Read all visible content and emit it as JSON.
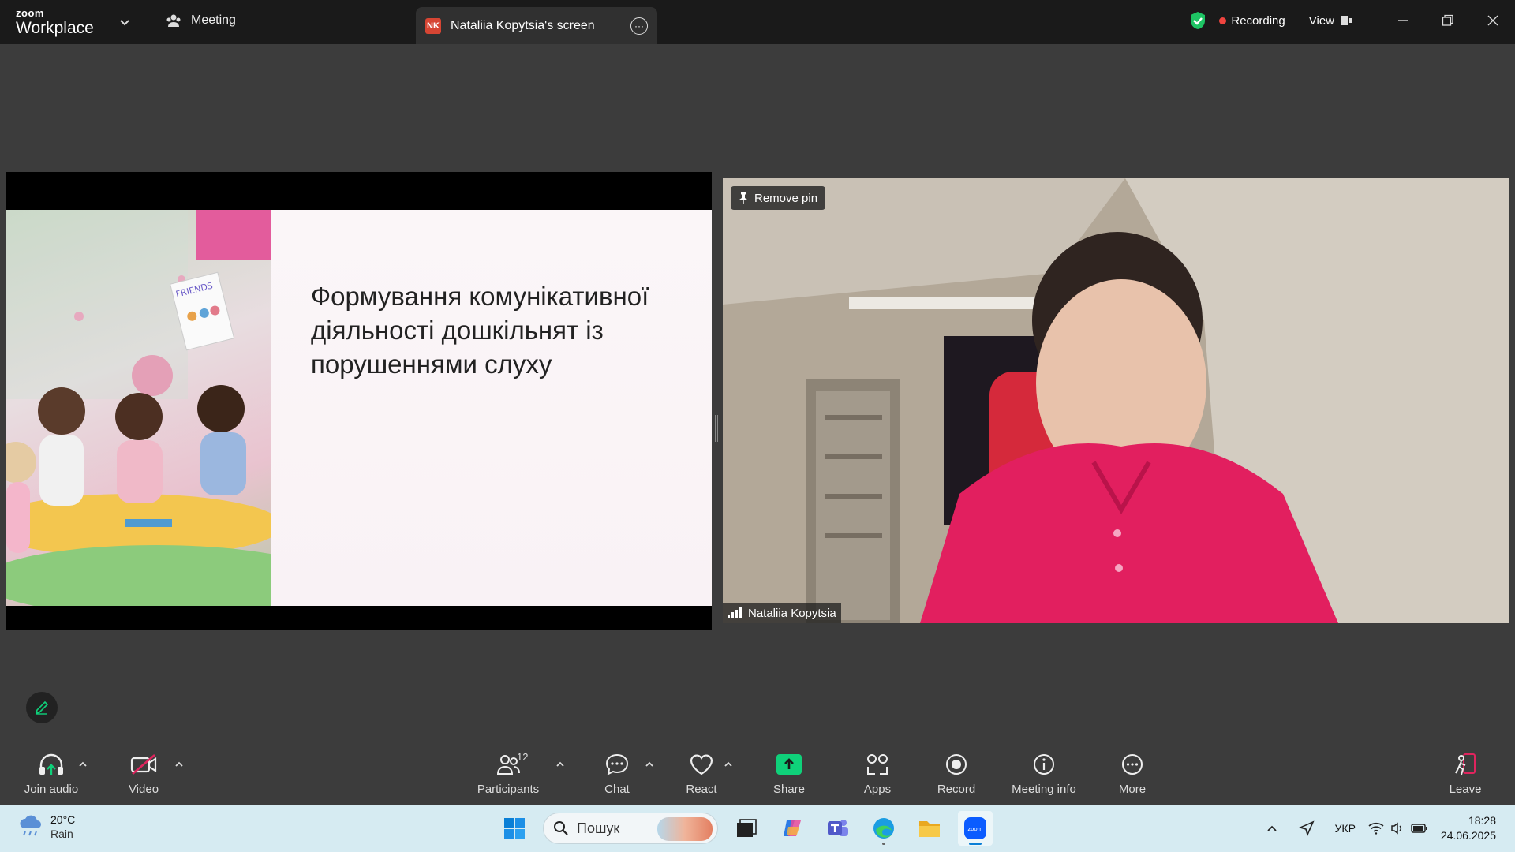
{
  "app": {
    "brand_small": "zoom",
    "brand_big": "Workplace",
    "meeting_tab_label": "Meeting",
    "screen_tab_initials": "NK",
    "screen_tab_label": "Nataliia Kopytsia's screen",
    "recording_label": "Recording",
    "view_label": "View"
  },
  "shared_slide": {
    "title": "Формування комунікативної діяльності дошкільнят із порушеннями слуху",
    "image_sign_text": "FRIENDS"
  },
  "video": {
    "pin_label": "Remove pin",
    "participant_name": "Nataliia Kopytsia"
  },
  "toolbar": {
    "join_audio": "Join audio",
    "video": "Video",
    "participants": "Participants",
    "participants_count": "12",
    "chat": "Chat",
    "react": "React",
    "share": "Share",
    "apps": "Apps",
    "record": "Record",
    "meeting_info": "Meeting info",
    "more": "More",
    "leave": "Leave"
  },
  "taskbar": {
    "weather_temp": "20°C",
    "weather_cond": "Rain",
    "search_placeholder": "Пошук",
    "language": "УКР",
    "time": "18:28",
    "date": "24.06.2025"
  },
  "colors": {
    "accent_green": "#0fd17a",
    "recording_red": "#f0443f",
    "leave_red": "#e0245e"
  }
}
